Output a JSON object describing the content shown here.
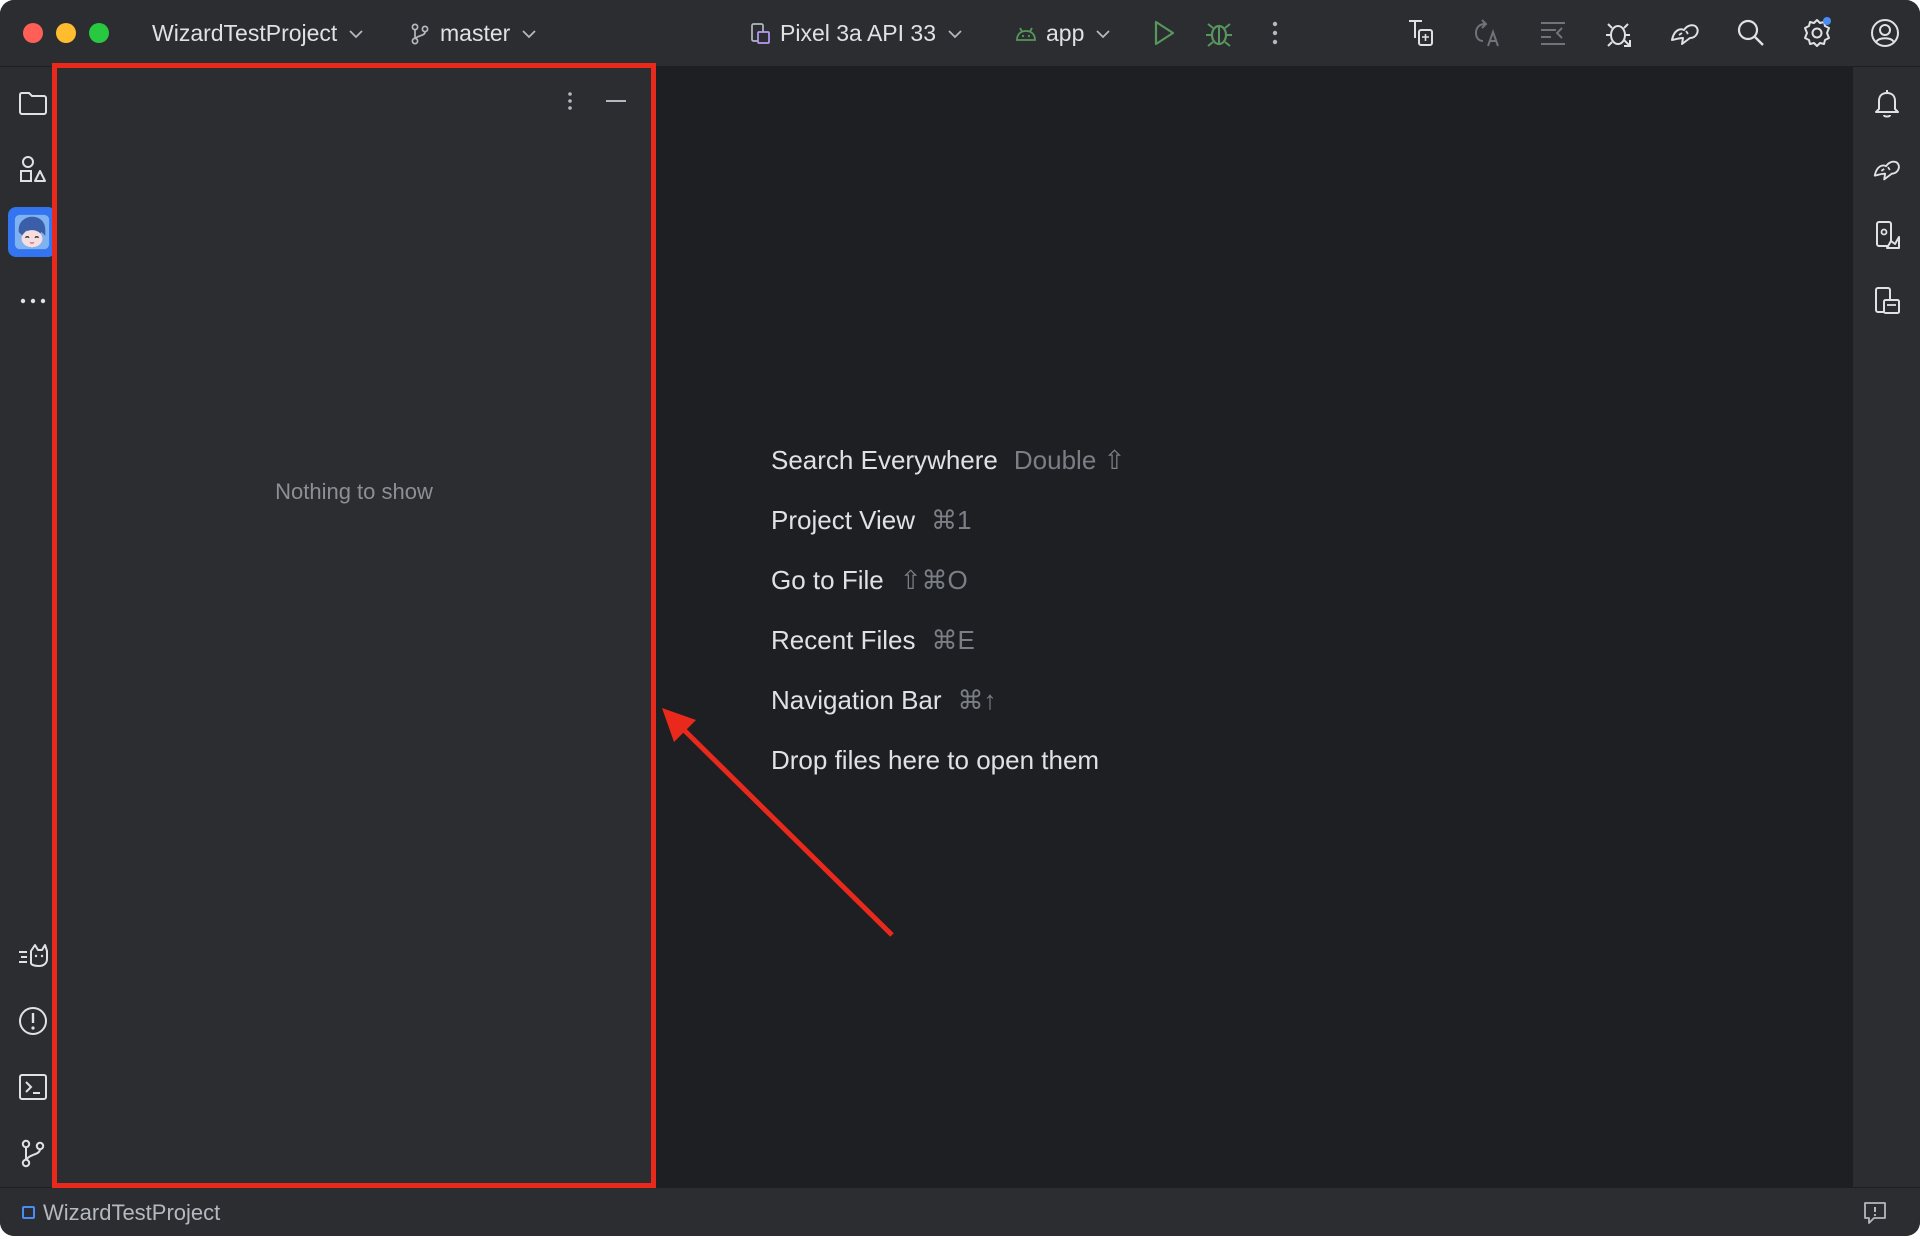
{
  "titlebar": {
    "project_name": "WizardTestProject",
    "branch": "master",
    "device": "Pixel 3a API 33",
    "run_config": "app",
    "icons": {
      "branch": "git-branch-icon",
      "device": "device-icon",
      "run_config": "android-icon",
      "run": "run-icon",
      "debug": "debug-icon",
      "more": "more-vertical-icon",
      "sync": "gradle-sync-icon",
      "translate": "translate-icon",
      "logcat": "logcat-icon",
      "profiler": "profiler-icon",
      "gemini": "gemini-icon",
      "search": "search-icon",
      "settings": "gear-icon",
      "account": "account-icon"
    },
    "colors": {
      "run": "#57965c",
      "debug": "#57965c",
      "settings_badge": "#4a8cf7"
    }
  },
  "left_stripe": {
    "top": [
      "folder-icon",
      "structure-icon",
      "avatar-plugin-icon",
      "more-horizontal-icon"
    ],
    "bottom": [
      "cat-build-icon",
      "problems-icon",
      "terminal-icon",
      "git-branch-icon"
    ]
  },
  "right_stripe": {
    "items": [
      "notifications-icon",
      "gemini-icon",
      "device-manager-icon",
      "running-devices-icon"
    ]
  },
  "tool_window": {
    "empty_text": "Nothing to show"
  },
  "editor": {
    "hints": [
      {
        "label": "Search Everywhere",
        "shortcut": "Double ⇧"
      },
      {
        "label": "Project View",
        "shortcut": "⌘1"
      },
      {
        "label": "Go to File",
        "shortcut": "⇧⌘O"
      },
      {
        "label": "Recent Files",
        "shortcut": "⌘E"
      },
      {
        "label": "Navigation Bar",
        "shortcut": "⌘↑"
      },
      {
        "label": "Drop files here to open them",
        "shortcut": ""
      }
    ]
  },
  "statusbar": {
    "project": "WizardTestProject",
    "icon": "event-log-icon"
  },
  "annotation": {
    "color": "#e8291c"
  }
}
